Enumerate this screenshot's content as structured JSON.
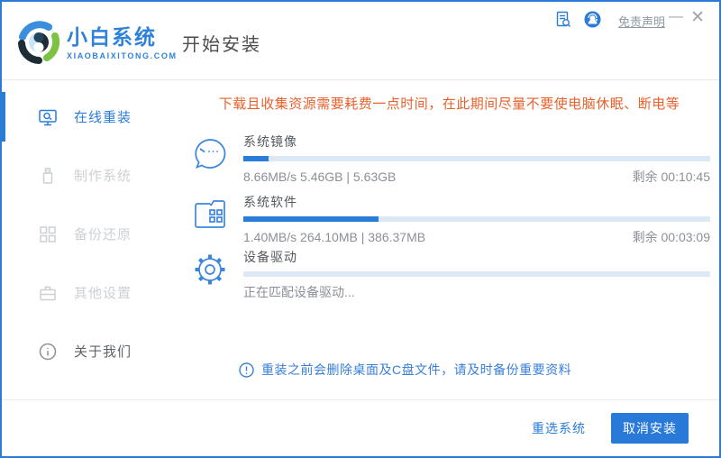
{
  "header": {
    "brand_name": "小白系统",
    "brand_domain": "XIAOBAIXITONG.COM",
    "page_title": "开始安装",
    "disclaimer_link": "免责声明",
    "minimize_glyph": "—",
    "close_glyph": "✕"
  },
  "sidebar": {
    "items": [
      {
        "label": "在线重装",
        "icon": "monitor-icon",
        "active": true
      },
      {
        "label": "制作系统",
        "icon": "usb-icon",
        "active": false
      },
      {
        "label": "备份还原",
        "icon": "backup-blocks-icon",
        "active": false
      },
      {
        "label": "其他设置",
        "icon": "toolbox-icon",
        "active": false
      },
      {
        "label": "关于我们",
        "icon": "info-icon",
        "active": false
      }
    ]
  },
  "main": {
    "tip": "下载且收集资源需要耗费一点时间，在此期间尽量不要使电脑休眠、断电等",
    "tasks": [
      {
        "title": "系统镜像",
        "icon": "face-icon",
        "progress_percent": 5.5,
        "status_left": "8.66MB/s 5.46GB | 5.63GB",
        "remaining": "剩余 00:10:45"
      },
      {
        "title": "系统软件",
        "icon": "folder-icon",
        "progress_percent": 29,
        "status_left": "1.40MB/s 264.10MB | 386.37MB",
        "remaining": "剩余 00:03:09"
      },
      {
        "title": "设备驱动",
        "icon": "gear-icon",
        "progress_percent": 0,
        "status_left": "正在匹配设备驱动...",
        "remaining": ""
      }
    ],
    "notice": "重装之前会删除桌面及C盘文件，请及时备份重要资料"
  },
  "footer": {
    "reselect_label": "重选系统",
    "cancel_label": "取消安装"
  },
  "colors": {
    "accent_blue": "#2b7cd9",
    "button_blue": "#2979d9",
    "tip_orange": "#e8612c",
    "progress_track": "#dce8f6",
    "progress_fill": "#2b7cd9",
    "window_border": "#2b7ad3",
    "logo_green": "#7dc242",
    "logo_dark": "#1d2c35"
  }
}
